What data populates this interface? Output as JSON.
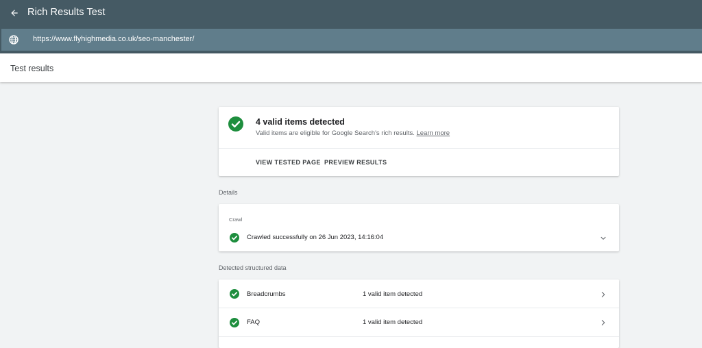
{
  "header": {
    "title": "Rich Results Test",
    "url": "https://www.flyhighmedia.co.uk/seo-manchester/"
  },
  "results_bar": {
    "title": "Test results"
  },
  "summary": {
    "heading": "4 valid items detected",
    "subtext": "Valid items are eligible for Google Search's rich results.",
    "learn_more": "Learn more",
    "actions": {
      "view_tested_page": "VIEW TESTED PAGE",
      "preview_results": "PREVIEW RESULTS"
    }
  },
  "details": {
    "section_label": "Details",
    "crawl": {
      "label": "Crawl",
      "status": "Crawled successfully on 26 Jun 2023, 14:16:04"
    }
  },
  "structured_data": {
    "section_label": "Detected structured data",
    "items": [
      {
        "name": "Breadcrumbs",
        "status": "1 valid item detected"
      },
      {
        "name": "FAQ",
        "status": "1 valid item detected"
      }
    ]
  },
  "colors": {
    "header_bg": "#455a64",
    "url_bar_bg": "#607d8b",
    "success_green": "#1e8e3e",
    "page_bg": "#f1f3f4"
  },
  "icons": {
    "back": "arrow-left-icon",
    "globe": "globe-icon",
    "check": "check-circle-icon",
    "expand": "chevron-down-icon",
    "open": "chevron-right-icon"
  }
}
